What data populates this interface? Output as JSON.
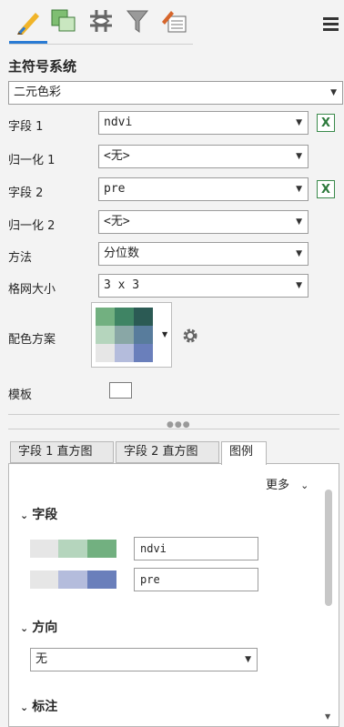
{
  "toolbar": {
    "tabs": [
      {
        "icon": "symbology-pencil-icon"
      },
      {
        "icon": "vary-symbology-icon"
      },
      {
        "icon": "grid-hash-icon"
      },
      {
        "icon": "filter-funnel-icon"
      },
      {
        "icon": "attribute-edit-icon"
      }
    ],
    "menu_icon": "hamburger-menu-icon"
  },
  "primary": {
    "title": "主符号系统",
    "method_value": "二元色彩"
  },
  "form": {
    "field1_label": "字段 1",
    "field1_value": "ndvi",
    "norm1_label": "归一化 1",
    "norm1_value": "<无>",
    "field2_label": "字段 2",
    "field2_value": "pre",
    "norm2_label": "归一化 2",
    "norm2_value": "<无>",
    "method_label": "方法",
    "method_value": "分位数",
    "grid_label": "格网大小",
    "grid_value": "3 x 3",
    "scheme_label": "配色方案",
    "template_label": "模板",
    "expression_icon": "X"
  },
  "colors": {
    "accent": "#2a7bd4",
    "ramp": [
      [
        "#72b080",
        "#3f8464",
        "#2b5a54"
      ],
      [
        "#b5d5bd",
        "#89a7a6",
        "#587c9c"
      ],
      [
        "#e6e6e6",
        "#b4bcdc",
        "#6a7fbb"
      ]
    ]
  },
  "tabs": [
    {
      "label": "字段 1 直方图"
    },
    {
      "label": "字段 2 直方图"
    },
    {
      "label": "图例"
    }
  ],
  "legend": {
    "more_label": "更多",
    "fields_title": "字段",
    "field1_value": "ndvi",
    "field2_value": "pre",
    "direction_title": "方向",
    "direction_value": "无",
    "labels_title": "标注"
  }
}
